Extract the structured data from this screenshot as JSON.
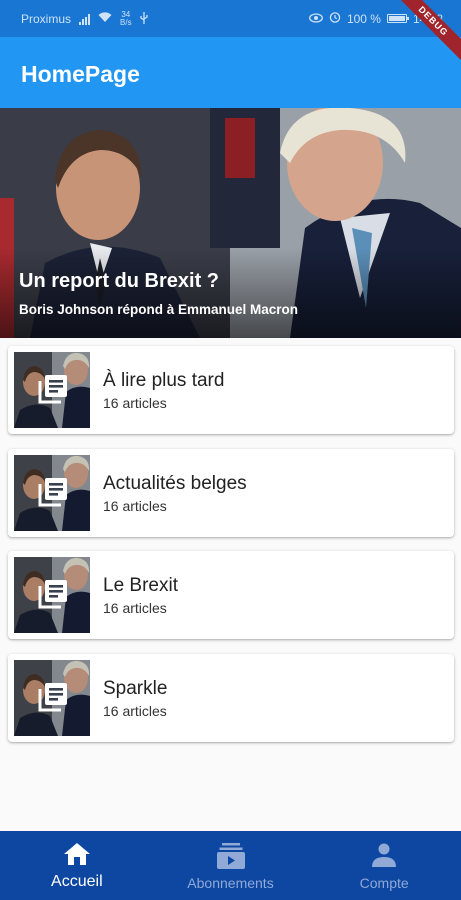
{
  "status_bar": {
    "carrier": "Proximus",
    "speed_value": "34",
    "speed_unit": "B/s",
    "battery": "100 %",
    "time": "14:18"
  },
  "debug_banner": "DEBUG",
  "app_bar": {
    "title": "HomePage"
  },
  "hero": {
    "title": "Un report du Brexit ?",
    "subtitle": "Boris Johnson répond à Emmanuel Macron"
  },
  "lists": [
    {
      "name": "À lire plus tard",
      "count": "16 articles"
    },
    {
      "name": "Actualités belges",
      "count": "16 articles"
    },
    {
      "name": "Le Brexit",
      "count": "16 articles"
    },
    {
      "name": "Sparkle",
      "count": "16 articles"
    }
  ],
  "bottom_nav": {
    "items": [
      {
        "label": "Accueil",
        "icon": "home-icon",
        "active": true
      },
      {
        "label": "Abonnements",
        "icon": "subscriptions-icon",
        "active": false
      },
      {
        "label": "Compte",
        "icon": "person-icon",
        "active": false
      }
    ]
  },
  "colors": {
    "app_bar": "#2196f3",
    "status_bar": "#1976d2",
    "bottom_nav": "#0d47a1",
    "debug_ribbon": "#a0242b"
  }
}
